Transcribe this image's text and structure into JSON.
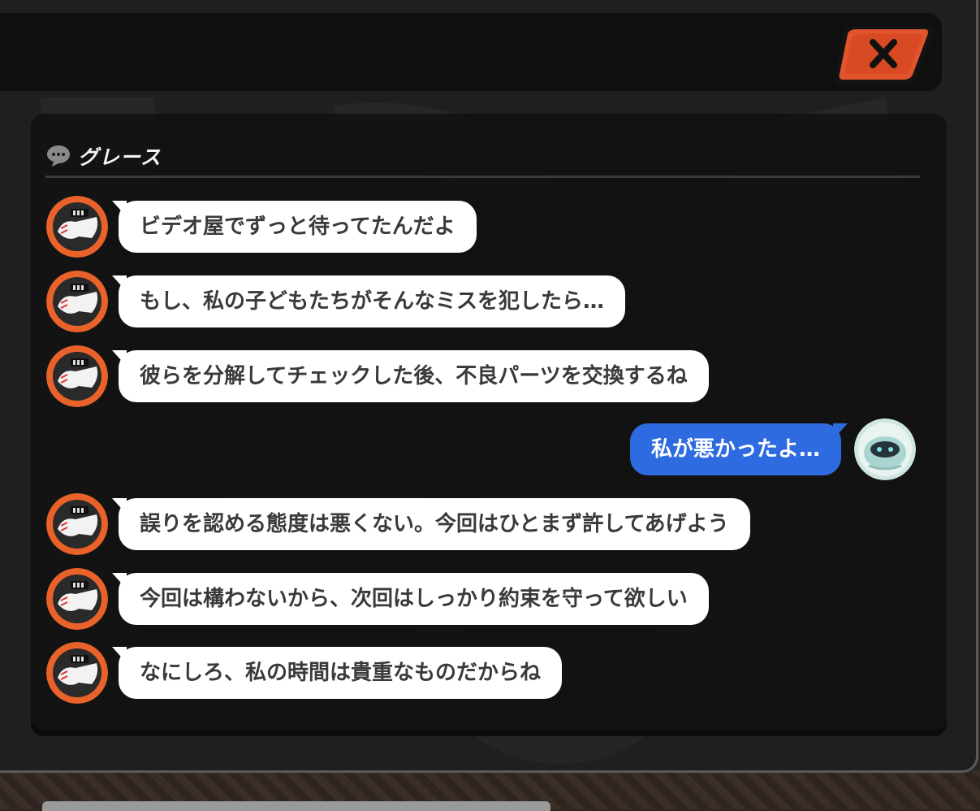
{
  "chat": {
    "title": "グレース",
    "messages": [
      {
        "sender": "grace",
        "text": "ビデオ屋でずっと待ってたんだよ"
      },
      {
        "sender": "grace",
        "text": "もし、私の子どもたちがそんなミスを犯したら…"
      },
      {
        "sender": "grace",
        "text": "彼らを分解してチェックした後、不良パーツを交換するね"
      },
      {
        "sender": "player",
        "text": "私が悪かったよ…"
      },
      {
        "sender": "grace",
        "text": "誤りを認める態度は悪くない。今回はひとまず許してあげよう"
      },
      {
        "sender": "grace",
        "text": "今回は構わないから、次回はしっかり約束を守って欲しい"
      },
      {
        "sender": "grace",
        "text": "なにしろ、私の時間は貴重なものだからね"
      }
    ]
  },
  "icons": {
    "close": "close-icon",
    "chat": "chat-bubble-icon",
    "grace_avatar": "grace-avatar",
    "player_avatar": "bangboo-avatar"
  },
  "colors": {
    "close_button": "#e1542c",
    "player_bubble": "#2e6be0",
    "npc_bubble": "#ffffff",
    "avatar_ring": "#e8622a"
  }
}
